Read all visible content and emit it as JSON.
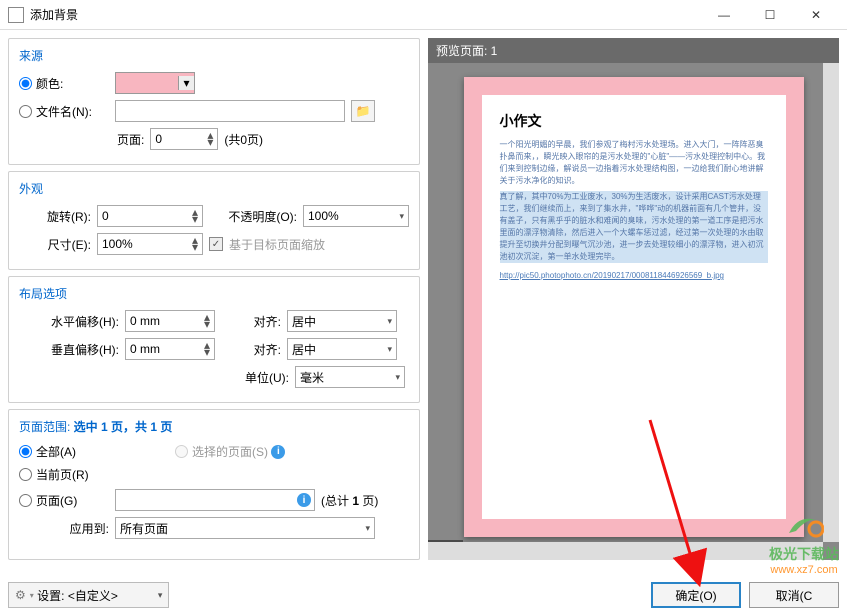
{
  "window": {
    "title": "添加背景",
    "min": "—",
    "max": "☐",
    "close": "✕"
  },
  "source": {
    "title": "来源",
    "color_label": "颜色:",
    "filename_label": "文件名(N):",
    "page_label": "页面:",
    "page_value": "0",
    "page_total": "(共0页)"
  },
  "appearance": {
    "title": "外观",
    "rotate_label": "旋转(R):",
    "rotate_value": "0",
    "opacity_label": "不透明度(O):",
    "opacity_value": "100%",
    "size_label": "尺寸(E):",
    "size_value": "100%",
    "scale_checkbox": "基于目标页面缩放"
  },
  "layout": {
    "title": "布局选项",
    "hoffset_label": "水平偏移(H):",
    "hoffset_value": "0 mm",
    "voffset_label": "垂直偏移(H):",
    "voffset_value": "0 mm",
    "align_label": "对齐:",
    "align_value": "居中",
    "unit_label": "单位(U):",
    "unit_value": "毫米"
  },
  "range": {
    "title_prefix": "页面范围: ",
    "title_value": "选中 1 页，共 1 页",
    "all_label": "全部(A)",
    "selected_label": "选择的页面(S)",
    "current_label": "当前页(R)",
    "pages_label": "页面(G)",
    "pages_total": "(总计 1 页)",
    "apply_label": "应用到:",
    "apply_value": "所有页面"
  },
  "preview": {
    "header": "预览页面: 1",
    "doc_title": "小作文",
    "para1": "一个阳光明媚的早晨，我们参观了梅村污水处理场。进入大门，一阵阵恶臭扑鼻而来，，瞬光映入眼帘的是污水处理的\"心脏\"——污水处理控制中心。我们来到控制边缘，解说员一边指着污水处理结构图，一边给我们耐心地讲解关于污水净化的知识。",
    "para2": "真了解，其中70%为工业废水，30%为生活废水，设计采用CAST污水处理工艺，我们继续而上，来到了集水井，\"哗哗\"动的机器前面有几个管井，没有盖子，只有黑乎乎的脏水和难闻的臭味，污水处理的第一道工序是把污水里面的漂浮物清除，然后进入一个大螺车惩过滤，经过第一次处理的水由取提升至切换井分配到曝气沉沙池，进一步去处理较细小的漂浮物，进入初沉池初次沉淀，第一单水处理完毕。",
    "link": "http://pic50.photophoto.cn/20190217/0008118446926569_b.jpg",
    "page_num": "1"
  },
  "footer": {
    "settings_label": "设置:",
    "settings_value": "<自定义>",
    "ok": "确定(O)",
    "cancel": "取消(C"
  },
  "watermark": {
    "line1": "极光下载站",
    "line2": "www.xz7.com"
  }
}
